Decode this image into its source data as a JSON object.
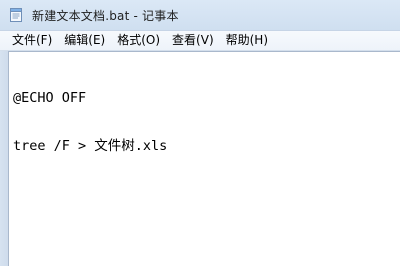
{
  "window": {
    "title": "新建文本文档.bat - 记事本"
  },
  "menu": {
    "items": [
      {
        "label": "文件(F)"
      },
      {
        "label": "编辑(E)"
      },
      {
        "label": "格式(O)"
      },
      {
        "label": "查看(V)"
      },
      {
        "label": "帮助(H)"
      }
    ]
  },
  "editor": {
    "lines": [
      "@ECHO OFF",
      "tree /F > 文件树.xls"
    ]
  },
  "icons": {
    "app": "notepad-icon"
  }
}
